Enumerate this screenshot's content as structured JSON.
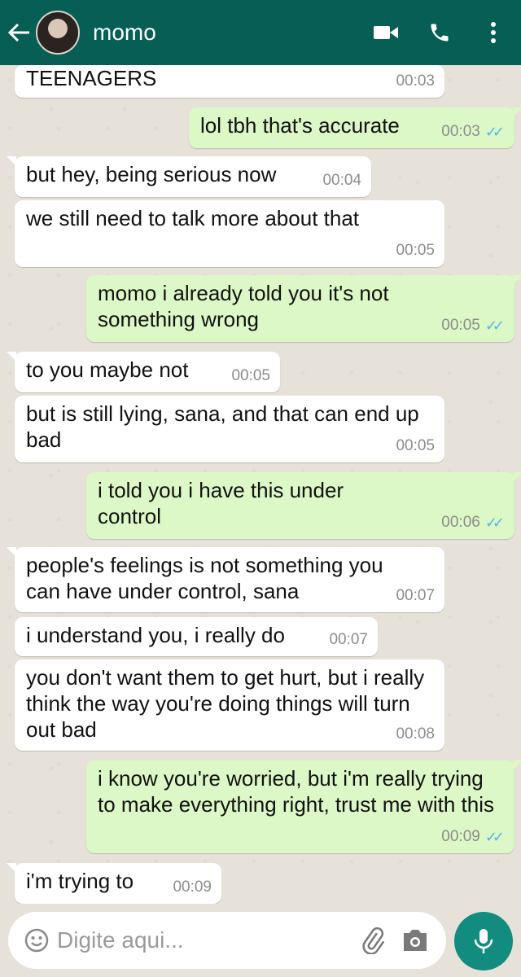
{
  "header": {
    "contact_name": "momo",
    "icons": [
      "back-arrow-icon",
      "video-call-icon",
      "phone-icon",
      "more-vert-icon"
    ],
    "color": "#075e54"
  },
  "messages": [
    {
      "dir": "in",
      "text": "TEENAGERS",
      "time": "00:03"
    },
    {
      "dir": "out",
      "text": "lol tbh that's accurate",
      "time": "00:03",
      "ticks": "✓✓"
    },
    {
      "dir": "in",
      "text": "but hey, being serious now",
      "time": "00:04"
    },
    {
      "dir": "in",
      "text": "we still need to talk more about that",
      "time": "00:05"
    },
    {
      "dir": "out",
      "text": "momo i already told you it's not something wrong",
      "time": "00:05",
      "ticks": "✓✓"
    },
    {
      "dir": "in",
      "text": "to you maybe not",
      "time": "00:05"
    },
    {
      "dir": "in",
      "text": "but is still lying, sana, and that can end up bad",
      "time": "00:05"
    },
    {
      "dir": "out",
      "text": "i told you i have this under control",
      "time": "00:06",
      "ticks": "✓✓"
    },
    {
      "dir": "in",
      "text": "people's feelings is not something you can have under control, sana",
      "time": "00:07"
    },
    {
      "dir": "in",
      "text": "i understand you, i really do",
      "time": "00:07"
    },
    {
      "dir": "in",
      "text": "you don't want them to get hurt, but i really think the way you're doing things will turn out bad",
      "time": "00:08"
    },
    {
      "dir": "out",
      "text": "i know you're worried, but i'm really trying to make everything right, trust me with this",
      "time": "00:09",
      "ticks": "✓✓"
    },
    {
      "dir": "in",
      "text": "i'm trying to",
      "time": "00:09"
    }
  ],
  "composer": {
    "placeholder": "Digite aqui...",
    "icons": [
      "emoji-icon",
      "attach-icon",
      "camera-icon",
      "mic-icon"
    ],
    "accent": "#128c7e"
  },
  "colors": {
    "incoming": "#ffffff",
    "outgoing": "#dcf8c6",
    "read_ticks": "#4fb6ec"
  }
}
